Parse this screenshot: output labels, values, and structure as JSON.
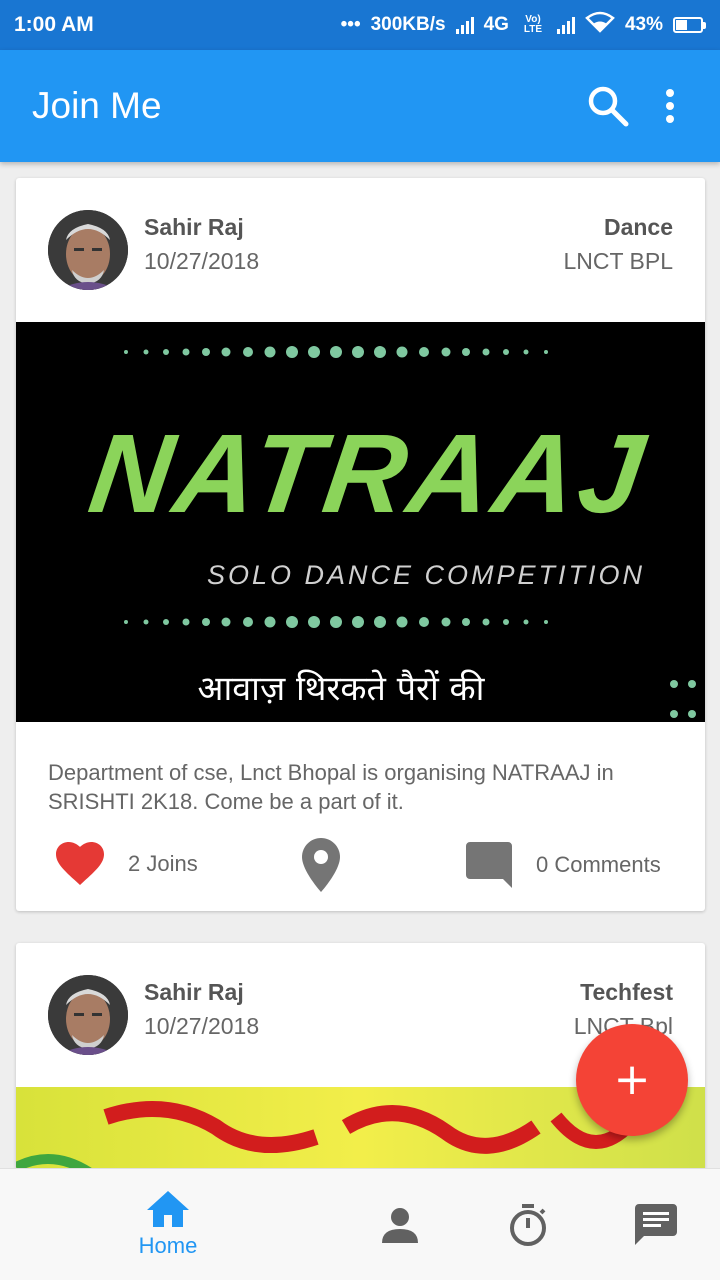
{
  "status_bar": {
    "time": "1:00 AM",
    "dots": "•••",
    "speed": "300KB/s",
    "network": "4G",
    "volte": "Vo) LTE",
    "battery": "43%"
  },
  "app_bar": {
    "title": "Join Me",
    "search_icon": "search-icon",
    "menu_icon": "more-vert-icon"
  },
  "posts": [
    {
      "author": "Sahir Raj",
      "date": "10/27/2018",
      "category": "Dance",
      "location": "LNCT BPL",
      "poster": {
        "title": "NATRAAJ",
        "subtitle": "SOLO DANCE COMPETITION",
        "hindi_text": "आवाज़ थिरकते पैरों की"
      },
      "description": "Department of cse, Lnct Bhopal is organising NATRAAJ in SRISHTI 2K18. Come be a part of it.",
      "joins_label": "2 Joins",
      "comments_label": "0 Comments"
    },
    {
      "author": "Sahir Raj",
      "date": "10/27/2018",
      "category": "Techfest",
      "location": "LNCT Bpl"
    }
  ],
  "fab": {
    "symbol": "+"
  },
  "bottom_nav": {
    "home_label": "Home"
  },
  "colors": {
    "primary": "#2196f3",
    "primary_dark": "#1976d2",
    "accent": "#f44336",
    "heart": "#e53935",
    "poster_green": "#8bd45a"
  }
}
